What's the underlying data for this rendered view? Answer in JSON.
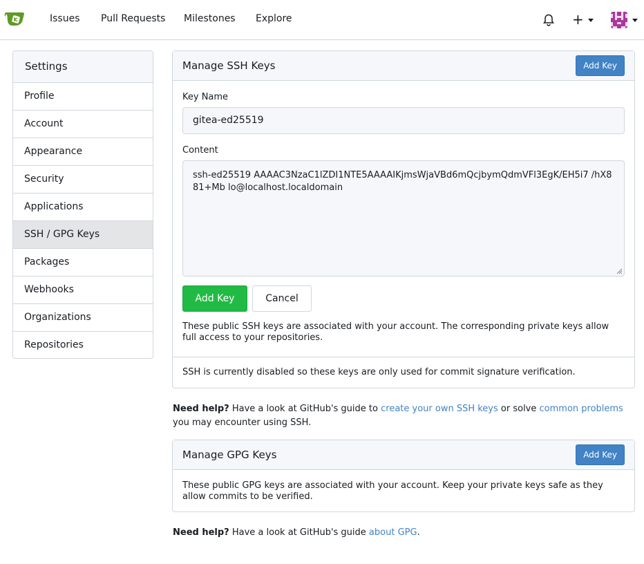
{
  "nav": {
    "items": [
      "Issues",
      "Pull Requests",
      "Milestones",
      "Explore"
    ]
  },
  "sidebar": {
    "title": "Settings",
    "items": [
      "Profile",
      "Account",
      "Appearance",
      "Security",
      "Applications",
      "SSH / GPG Keys",
      "Packages",
      "Webhooks",
      "Organizations",
      "Repositories"
    ],
    "active": "SSH / GPG Keys"
  },
  "ssh": {
    "title": "Manage SSH Keys",
    "add_key_label": "Add Key",
    "key_name_label": "Key Name",
    "key_name_value": "gitea-ed25519",
    "content_label": "Content",
    "content_value": "ssh-ed25519 AAAAC3NzaC1lZDI1NTE5AAAAIKjmsWjaVBd6mQcjbymQdmVFl3EgK/EH5i7 /hX881+Mb lo@localhost.localdomain",
    "submit_label": "Add Key",
    "cancel_label": "Cancel",
    "info_text": "These public SSH keys are associated with your account. The corresponding private keys allow full access to your repositories.",
    "disabled_text": "SSH is currently disabled so these keys are only used for commit signature verification."
  },
  "ssh_help": {
    "bold": "Need help?",
    "text1": " Have a look at GitHub's guide to ",
    "link1": "create your own SSH keys",
    "text2": " or solve ",
    "link2": "common problems",
    "text3": " you may encounter using SSH."
  },
  "gpg": {
    "title": "Manage GPG Keys",
    "add_key_label": "Add Key",
    "info_text": "These public GPG keys are associated with your account. Keep your private keys safe as they allow commits to be verified."
  },
  "gpg_help": {
    "bold": "Need help?",
    "text1": " Have a look at GitHub's guide ",
    "link1": "about GPG",
    "text2": "."
  },
  "colors": {
    "accent": "#4183c4",
    "green": "#21ba45",
    "logo": "#609926"
  }
}
